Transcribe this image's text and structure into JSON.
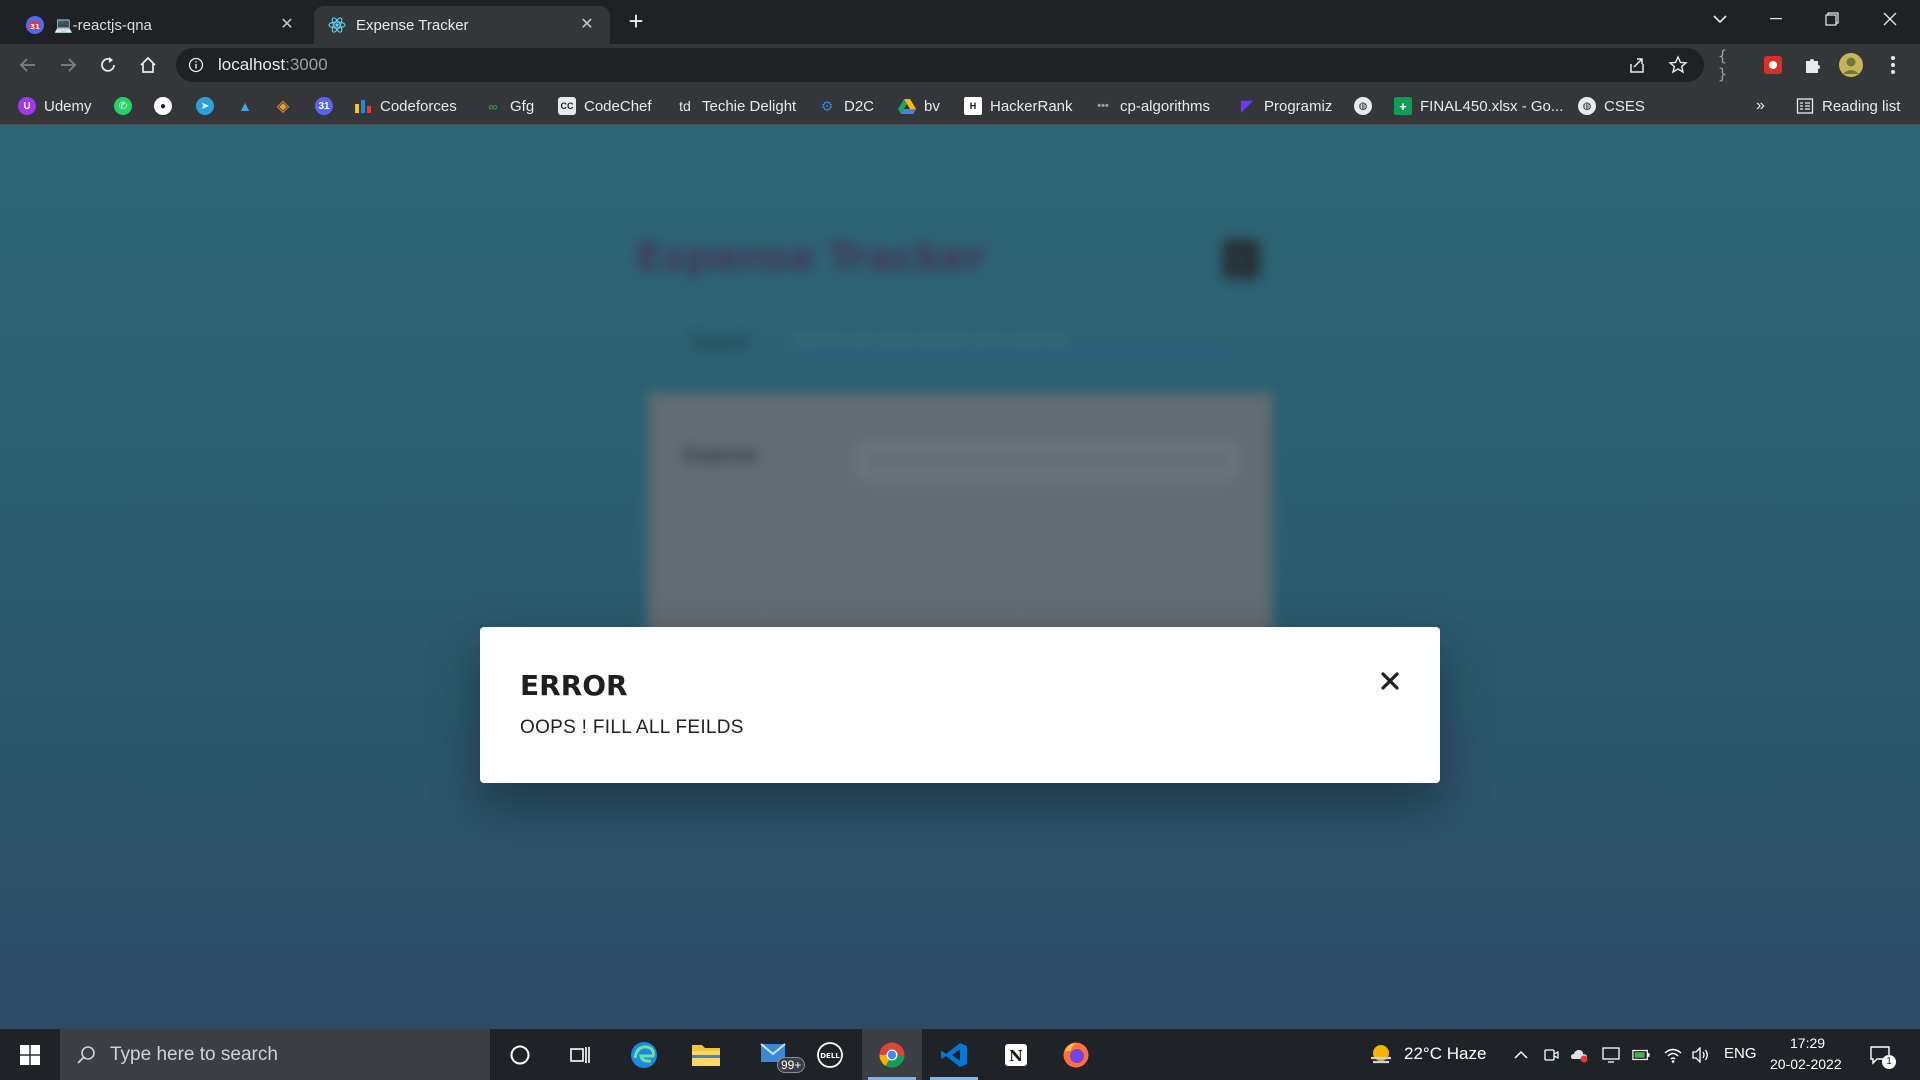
{
  "browser": {
    "tabs": [
      {
        "title": "💻-reactjs-qna",
        "active": false
      },
      {
        "title": "Expense Tracker",
        "active": true
      }
    ],
    "url_host": "localhost",
    "url_port": ":3000"
  },
  "bookmarks": [
    {
      "label": "Udemy",
      "icon": "udemy-icon",
      "color": "#a435f0"
    },
    {
      "label": "",
      "icon": "whatsapp-icon",
      "color": "#25d366"
    },
    {
      "label": "",
      "icon": "github-icon",
      "color": "#ffffff"
    },
    {
      "label": "",
      "icon": "telegram-icon",
      "color": "#2aa1da"
    },
    {
      "label": "",
      "icon": "mountain-icon",
      "color": "#3ea8e6"
    },
    {
      "label": "",
      "icon": "diamond-icon",
      "color": "#f0a030"
    },
    {
      "label": "",
      "icon": "calendar-icon",
      "color": "#5865f2"
    },
    {
      "label": "Codeforces",
      "icon": "codeforces-icon",
      "color": "#f3c425"
    },
    {
      "label": "Gfg",
      "icon": "gfg-icon",
      "color": "#2f8d46"
    },
    {
      "label": "CodeChef",
      "icon": "codechef-icon",
      "color": "#8a6a55"
    },
    {
      "label": "Techie Delight",
      "icon": "td-icon",
      "color": "#e8eaed"
    },
    {
      "label": "D2C",
      "icon": "d2c-icon",
      "color": "#3a7bd5"
    },
    {
      "label": "bv",
      "icon": "drive-icon",
      "color": "#1fa463"
    },
    {
      "label": "HackerRank",
      "icon": "hackerrank-icon",
      "color": "#111111"
    },
    {
      "label": "cp-algorithms",
      "icon": "cp-icon",
      "color": "#9aa0a6"
    },
    {
      "label": "Programiz",
      "icon": "programiz-icon",
      "color": "#6b36ff"
    },
    {
      "label": "",
      "icon": "globe-icon",
      "color": "#e8eaed"
    },
    {
      "label": "FINAL450.xlsx - Go...",
      "icon": "sheets-icon",
      "color": "#0f9d58"
    },
    {
      "label": "CSES",
      "icon": "globe-icon",
      "color": "#e8eaed"
    }
  ],
  "bookmarks_more": "»",
  "reading_list": "Reading list",
  "app": {
    "title": "Expense Tracker",
    "theme_button": "☾",
    "search_label": "Search",
    "search_placeholder": "Enter the user whose expense you're searching",
    "expense_label": "Expense"
  },
  "modal": {
    "heading": "ERROR",
    "message": "OOPS ! FILL ALL FEILDS"
  },
  "taskbar": {
    "search_placeholder": "Type here to search",
    "mail_badge": "99+",
    "weather": "22°C  Haze",
    "language": "ENG",
    "time": "17:29",
    "date": "20-02-2022",
    "notification_count": "1"
  },
  "colors": {
    "page_bg_top": "#2d6575",
    "page_bg_bottom": "#2d4a66",
    "title_color": "#4a2f55",
    "modal_bg": "#ffffff"
  }
}
